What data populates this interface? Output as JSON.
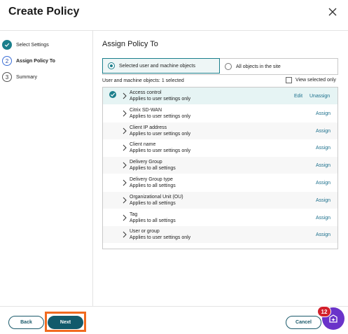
{
  "dialog": {
    "title": "Create Policy"
  },
  "steps": [
    {
      "number": "✓",
      "label": "Select Settings",
      "state": "done"
    },
    {
      "number": "2",
      "label": "Assign Policy To",
      "state": "active"
    },
    {
      "number": "3",
      "label": "Summary",
      "state": "pending"
    }
  ],
  "main": {
    "section_title": "Assign Policy To",
    "radio_selected": "Selected user and machine objects",
    "radio_other": "All objects in the site",
    "count_text": "User and machine objects: 1 selected",
    "view_selected": "View selected only"
  },
  "rows": [
    {
      "name": "Access control",
      "sub": "Applies to user settings only",
      "selected": true,
      "edit": "Edit",
      "unassign": "Unassign"
    },
    {
      "name": "Citrix SD-WAN",
      "sub": "Applies to user settings only",
      "action": "Assign"
    },
    {
      "name": "Client IP address",
      "sub": "Applies to user settings only",
      "action": "Assign"
    },
    {
      "name": "Client name",
      "sub": "Applies to user settings only",
      "action": "Assign"
    },
    {
      "name": "Delivery Group",
      "sub": "Applies to all settings",
      "action": "Assign"
    },
    {
      "name": "Delivery Group type",
      "sub": "Applies to all settings",
      "action": "Assign"
    },
    {
      "name": "Organizational Unit (OU)",
      "sub": "Applies to all settings",
      "action": "Assign"
    },
    {
      "name": "Tag",
      "sub": "Applies to all settings",
      "action": "Assign"
    },
    {
      "name": "User or group",
      "sub": "Applies to user settings only",
      "action": "Assign"
    }
  ],
  "footer": {
    "back": "Back",
    "next": "Next",
    "cancel": "Cancel"
  },
  "assistant": {
    "badge": "12",
    "icon": "assistant-icon"
  },
  "colors": {
    "accent": "#1b7f8c",
    "primary_button": "#125a6b",
    "highlight": "#f06a1f",
    "assistant": "#6a33c9",
    "badge": "#d3212c"
  }
}
